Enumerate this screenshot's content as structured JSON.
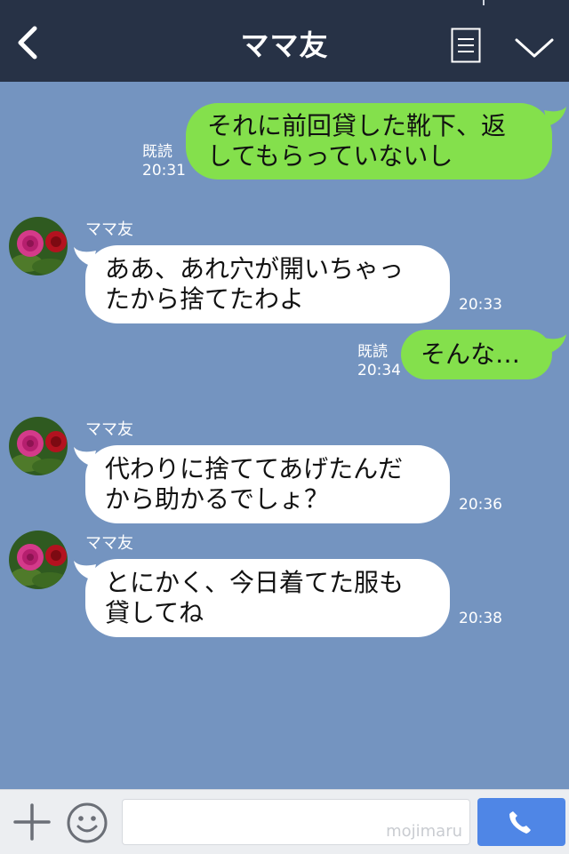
{
  "header": {
    "title": "ママ友"
  },
  "messages": [
    {
      "side": "me",
      "text": "それに前回貸した靴下、返\nしてもらっていないし",
      "read": "既読",
      "time": "20:31"
    },
    {
      "side": "them",
      "name": "ママ友",
      "text": "ああ、あれ穴が開いちゃっ\nたから捨てたわよ",
      "time": "20:33"
    },
    {
      "side": "me",
      "text": "そんな…",
      "read": "既読",
      "time": "20:34"
    },
    {
      "side": "them",
      "name": "ママ友",
      "text": "代わりに捨ててあげたんだ\nから助かるでしょ？",
      "time": "20:36"
    },
    {
      "side": "them",
      "name": "ママ友",
      "text": "とにかく、今日着てた服も\n貸してね",
      "time": "20:38"
    }
  ],
  "footer": {
    "watermark": "mojimaru"
  },
  "colors": {
    "header": "#273246",
    "background": "#7494c0",
    "my_bubble": "#84e04c",
    "their_bubble": "#ffffff",
    "call_button": "#4f86e6"
  },
  "icons": {
    "back": "chevron-left-icon",
    "menu": "list-icon",
    "expand": "chevron-down-icon",
    "add": "plus-icon",
    "emoji": "smile-icon",
    "call": "phone-icon"
  }
}
